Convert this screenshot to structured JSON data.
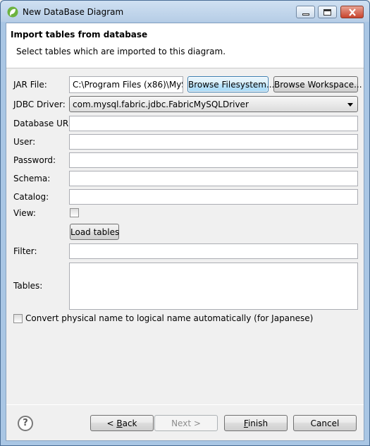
{
  "window": {
    "title": "New DataBase Diagram",
    "controls": {
      "minimize": "minimize",
      "maximize": "maximize",
      "close": "close"
    }
  },
  "header": {
    "title": "Import tables from database",
    "description": "Select tables which are imported to this diagram."
  },
  "form": {
    "jar_file": {
      "label": "JAR File:",
      "value": "C:\\Program Files (x86)\\MyS"
    },
    "browse_filesystem": "Browse Filesystem...",
    "browse_workspace": "Browse Workspace...",
    "jdbc_driver": {
      "label": "JDBC Driver:",
      "value": "com.mysql.fabric.jdbc.FabricMySQLDriver"
    },
    "database_uri": {
      "label": "Database URI:",
      "value": ""
    },
    "user": {
      "label": "User:",
      "value": ""
    },
    "password": {
      "label": "Password:",
      "value": ""
    },
    "schema": {
      "label": "Schema:",
      "value": ""
    },
    "catalog": {
      "label": "Catalog:",
      "value": ""
    },
    "view": {
      "label": "View:",
      "checked": false
    },
    "load_tables": "Load tables",
    "filter": {
      "label": "Filter:",
      "value": ""
    },
    "tables": {
      "label": "Tables:",
      "items": []
    },
    "convert": {
      "label": "Convert physical name to logical name automatically (for Japanese)",
      "checked": false
    }
  },
  "footer": {
    "help_icon": "?",
    "back": {
      "prefix": "< ",
      "mnemonic": "B",
      "rest": "ack"
    },
    "next": "Next >",
    "finish": {
      "mnemonic": "F",
      "rest": "inish"
    },
    "cancel": "Cancel"
  }
}
